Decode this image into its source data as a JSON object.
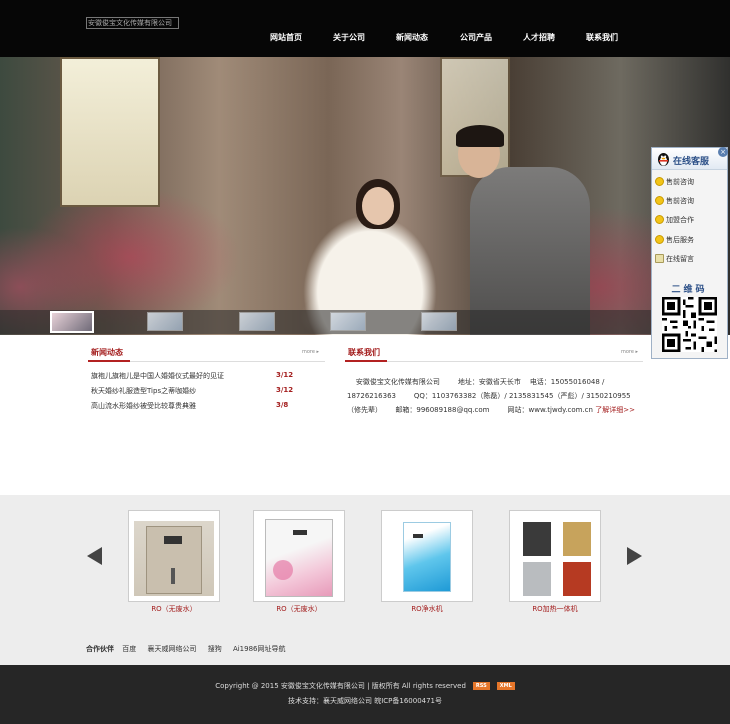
{
  "header": {
    "logo_alt": "安徽俊宝文化传媒有限公司",
    "nav": [
      "网站首页",
      "关于公司",
      "新闻动态",
      "公司产品",
      "人才招聘",
      "联系我们"
    ]
  },
  "banner": {
    "slide_count": 5,
    "active_slide": 1
  },
  "news": {
    "title": "新闻动态",
    "more": "more",
    "items": [
      {
        "title": "旗袍儿旗袍儿是中国人婚婚仪式最好的见证",
        "date": "3/12"
      },
      {
        "title": "秋天婚纱礼服造型Tips之蒂咖婚纱",
        "date": "3/12"
      },
      {
        "title": "高山流水形婚纱被受比较尊贵典雅",
        "date": "3/8"
      }
    ]
  },
  "contact": {
    "title": "联系我们",
    "more": "more",
    "company": "安徽俊宝文化传媒有限公司",
    "address": "地址：安徽省天长市",
    "phone": "电话：15055016048 / 18726216363",
    "qq": "QQ：1103763382（陈磊）/ 2135831545（严彪）/ 3150210955（修先辈）",
    "email": "邮箱：996089188@qq.com",
    "website": "网站：www.tjwdy.com.cn",
    "detail_link": "了解详细>>"
  },
  "products": {
    "items": [
      {
        "caption": "RO（无废水）"
      },
      {
        "caption": "RO（无废水）"
      },
      {
        "caption": "RO净水机"
      },
      {
        "caption": "RO加热一体机"
      }
    ]
  },
  "partners": {
    "label": "合作伙伴",
    "links": [
      "百度",
      "襄天威网络公司",
      "搜狗",
      "Ai1986网址导航"
    ]
  },
  "footer": {
    "copyright": "Copyright @ 2015 安徽俊宝文化传媒有限公司 | 版权所有  All rights reserved",
    "rss": "RSS",
    "xml": "XML",
    "support": "技术支持：襄天威网络公司   皖ICP备16000471号"
  },
  "qq_panel": {
    "title": "在线客服",
    "close": "×",
    "items": [
      "售前咨询",
      "售前咨询",
      "加盟合作",
      "售后服务",
      "在线留言"
    ],
    "qr_title": "二维码"
  },
  "colors": {
    "accent": "#a31d1d",
    "header_bg": "#060606",
    "footer_bg": "#262626",
    "badge": "#e6762a",
    "qq_blue": "#2b4f87"
  }
}
